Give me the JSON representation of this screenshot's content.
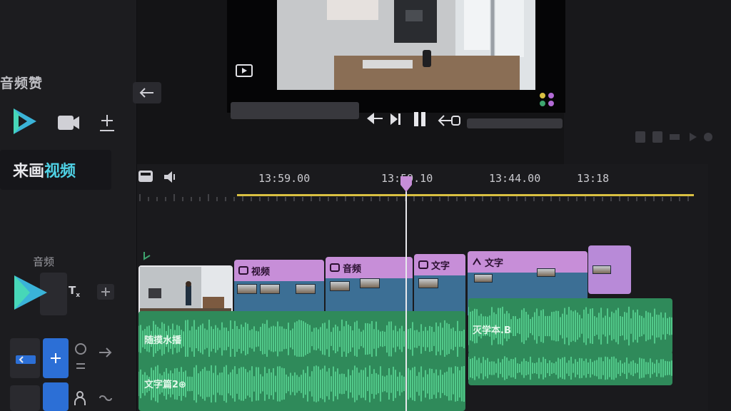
{
  "left_panel": {
    "title": "音频赞",
    "brand_part1": "来画",
    "brand_part2": "视频",
    "audio_section_label": "音频",
    "tools": [
      {
        "name": "play-logo-icon"
      },
      {
        "name": "camera-icon"
      },
      {
        "name": "add-remove-icon"
      }
    ]
  },
  "timeline": {
    "timecodes": [
      "13:59.00",
      "13:59.10",
      "13:44.00",
      "13:18"
    ],
    "clips": [
      {
        "label": "视频",
        "icon": "video-icon"
      },
      {
        "label": "音频",
        "icon": "audio-icon"
      },
      {
        "label": "文字",
        "icon": "text-icon"
      },
      {
        "label": "文字",
        "icon": "text-icon"
      }
    ],
    "audio_labels": {
      "track1_left": "随摸水播",
      "track1_right": "灭学本.B",
      "track2_left": "文字篇2⊕"
    }
  },
  "colors": {
    "accent": "#2c6fd6",
    "clip_header": "#c78ed8",
    "audio_wave": "#3ea56f",
    "playhead": "#e8e8ec",
    "ruler_accent": "#d9c042"
  }
}
